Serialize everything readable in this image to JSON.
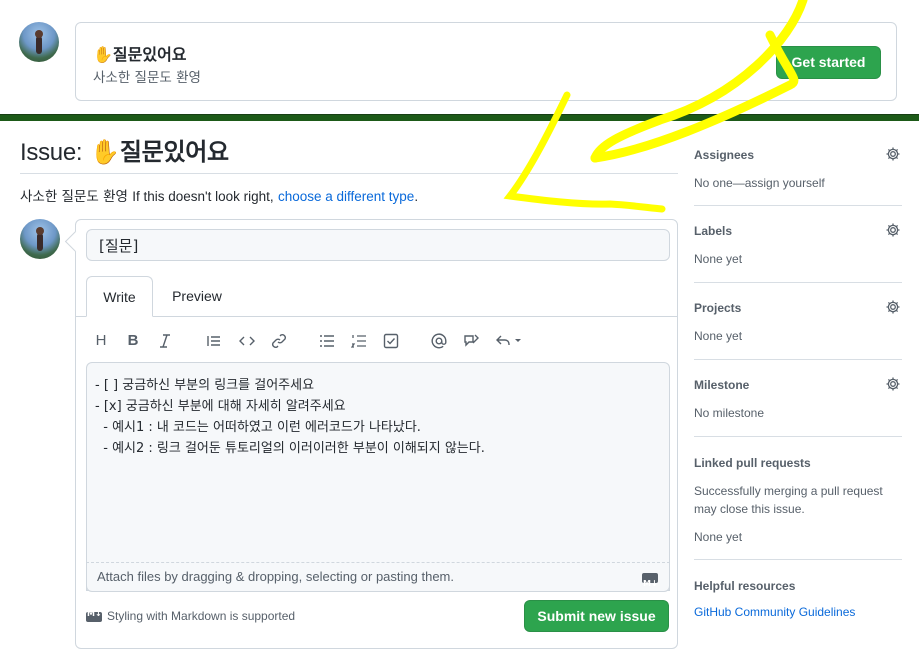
{
  "template": {
    "title": "✋질문있어요",
    "description": "사소한 질문도 환영",
    "button_label": "Get started"
  },
  "issue": {
    "heading_prefix": "Issue:",
    "heading_name": "✋질문있어요",
    "about": "사소한 질문도 환영",
    "not_right_text": "If this doesn't look right,",
    "choose_link": "choose a different type",
    "period": "."
  },
  "form": {
    "title_value": "[질문]",
    "tabs": [
      {
        "label": "Write"
      },
      {
        "label": "Preview"
      }
    ],
    "toolbar_icons": [
      "heading-icon",
      "bold-icon",
      "italic-icon",
      "quote-icon",
      "code-icon",
      "link-icon",
      "bulleted-list-icon",
      "numbered-list-icon",
      "task-list-icon",
      "mention-icon",
      "cross-reference-icon",
      "reply-icon"
    ],
    "body_lines": [
      "- [ ] 궁금하신 부분의 링크를 걸어주세요",
      "- [x] 궁금하신 부분에 대해 자세히 알려주세요",
      "  - 예시1 : 내 코드는 어떠하였고 이런 에러코드가 나타났다.",
      "  - 예시2 : 링크 걸어둔 튜토리얼의 이러이러한 부분이 이해되지 않는다."
    ],
    "attach_text": "Attach files by dragging & dropping, selecting or pasting them.",
    "markdown_note": "Styling with Markdown is supported",
    "submit_label": "Submit new issue"
  },
  "sidebar": {
    "assignees": {
      "heading": "Assignees",
      "value": "No one—assign yourself"
    },
    "labels": {
      "heading": "Labels",
      "value": "None yet"
    },
    "projects": {
      "heading": "Projects",
      "value": "None yet"
    },
    "milestone": {
      "heading": "Milestone",
      "value": "No milestone"
    },
    "linked_prs": {
      "heading": "Linked pull requests",
      "description_line1": "Successfully merging a pull request",
      "description_line2": "may close this issue.",
      "value": "None yet"
    },
    "helpful": {
      "heading": "Helpful resources",
      "link": "GitHub Community Guidelines"
    }
  },
  "colors": {
    "accent_green": "#2da44e",
    "link_blue": "#0969da",
    "divider_green": "#1d5a18",
    "annotation_yellow": "#ffff00"
  }
}
